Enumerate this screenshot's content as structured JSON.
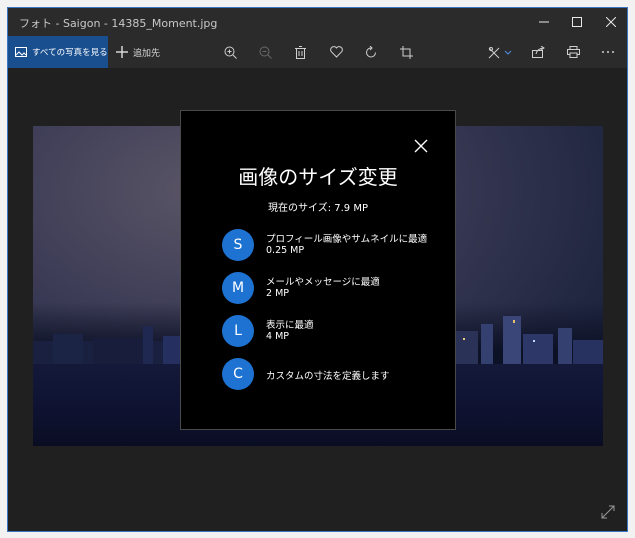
{
  "window": {
    "title": "フォト - Saigon - 14385_Moment.jpg",
    "accent": "#1e73d2"
  },
  "toolbar": {
    "see_all_label": "すべての写真を見る",
    "add_label": "追加先"
  },
  "icons": {
    "see_all": "photos-icon",
    "add": "plus-icon",
    "zoom_in": "zoom-in-icon",
    "zoom_out": "zoom-out-icon",
    "delete": "trash-icon",
    "favorite": "heart-icon",
    "rotate": "rotate-icon",
    "crop": "crop-icon",
    "edit": "edit-create-icon",
    "share": "share-icon",
    "print": "print-icon",
    "more": "more-icon",
    "expand": "expand-icon",
    "close": "close-icon"
  },
  "dialog": {
    "title": "画像のサイズ変更",
    "current_size": "現在のサイズ: 7.9 MP",
    "options": [
      {
        "letter": "S",
        "label": "プロフィール画像やサムネイルに最適",
        "size": "0.25 MP"
      },
      {
        "letter": "M",
        "label": "メールやメッセージに最適",
        "size": "2 MP"
      },
      {
        "letter": "L",
        "label": "表示に最適",
        "size": "4 MP"
      },
      {
        "letter": "C",
        "label": "カスタムの寸法を定義します",
        "size": ""
      }
    ]
  }
}
